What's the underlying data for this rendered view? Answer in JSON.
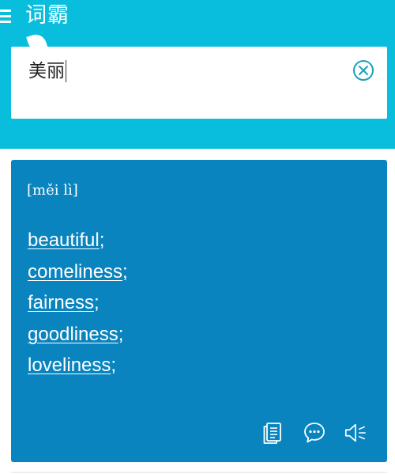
{
  "app": {
    "title": "词霸"
  },
  "search": {
    "query": "美丽"
  },
  "result": {
    "phonetic": "[měi lì]",
    "translations": [
      {
        "word": "beautiful",
        "sep": ";"
      },
      {
        "word": "comeliness",
        "sep": ";"
      },
      {
        "word": "fairness",
        "sep": ";"
      },
      {
        "word": "goodliness",
        "sep": ";"
      },
      {
        "word": "loveliness",
        "sep": ";"
      }
    ]
  },
  "icons": {
    "menu": "menu-icon",
    "clear": "clear-circle-x-icon",
    "document": "document-icon",
    "comment": "comment-icon",
    "speaker": "speaker-icon"
  },
  "colors": {
    "header": "#09bedd",
    "card": "#0a84bf",
    "clear_icon": "#1aa3b8"
  }
}
